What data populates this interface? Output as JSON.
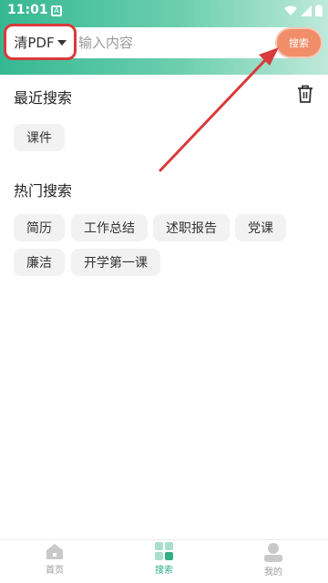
{
  "status_bar": {
    "time": "11:01",
    "notification_glyph": "A"
  },
  "search": {
    "category": "清PDF",
    "placeholder": "输入内容",
    "button_label": "搜索"
  },
  "recent": {
    "title": "最近搜索",
    "items": [
      "课件"
    ]
  },
  "hot": {
    "title": "热门搜索",
    "items": [
      "简历",
      "工作总结",
      "述职报告",
      "党课",
      "廉洁",
      "开学第一课"
    ]
  },
  "bottom_nav": {
    "items": [
      {
        "label": "首页",
        "icon": "home-icon",
        "active": false
      },
      {
        "label": "搜索",
        "icon": "search-grid-icon",
        "active": true
      },
      {
        "label": "我的",
        "icon": "profile-icon",
        "active": false
      }
    ]
  },
  "colors": {
    "accent": "#2fae87",
    "search_button": "#f08e6a",
    "annotation": "#d93a3a"
  }
}
